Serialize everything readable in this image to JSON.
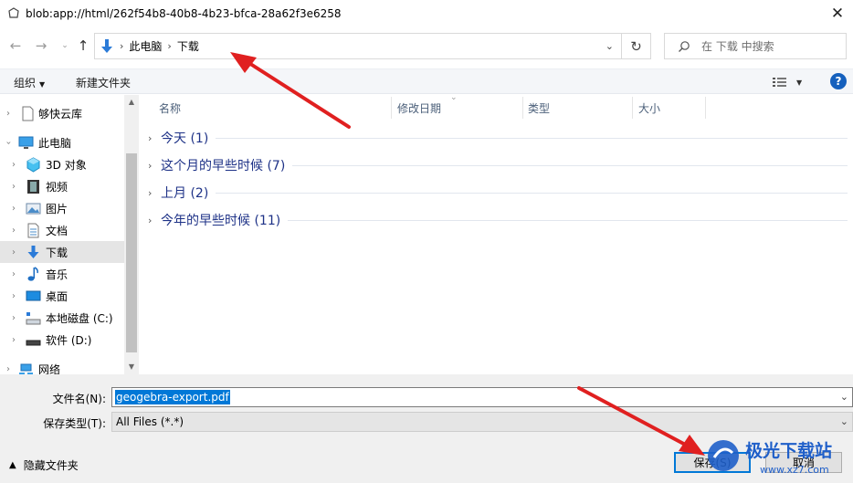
{
  "window": {
    "title": "blob:app://html/262f54b8-40b8-4b23-bfca-28a62f3e6258",
    "close_glyph": "✕"
  },
  "address": {
    "crumb_root": "此电脑",
    "crumb_current": "下载",
    "search_placeholder": "在 下载 中搜索"
  },
  "toolbar": {
    "organize_label": "组织",
    "new_folder_label": "新建文件夹"
  },
  "nav": {
    "items": [
      {
        "label": "够快云库",
        "icon": "document-icon"
      },
      {
        "label": "此电脑",
        "icon": "computer-icon"
      },
      {
        "label": "3D 对象",
        "icon": "cube-3d-icon"
      },
      {
        "label": "视频",
        "icon": "video-icon"
      },
      {
        "label": "图片",
        "icon": "picture-icon"
      },
      {
        "label": "文档",
        "icon": "documents-icon"
      },
      {
        "label": "下载",
        "icon": "download-icon"
      },
      {
        "label": "音乐",
        "icon": "music-icon"
      },
      {
        "label": "桌面",
        "icon": "desktop-icon"
      },
      {
        "label": "本地磁盘 (C:)",
        "icon": "drive-c-icon"
      },
      {
        "label": "软件 (D:)",
        "icon": "drive-d-icon"
      },
      {
        "label": "网络",
        "icon": "network-icon"
      }
    ],
    "selected": "下载"
  },
  "columns": {
    "name": "名称",
    "modified": "修改日期",
    "type": "类型",
    "size": "大小"
  },
  "groups": [
    {
      "title": "今天 (1)"
    },
    {
      "title": "这个月的早些时候 (7)"
    },
    {
      "title": "上月 (2)"
    },
    {
      "title": "今年的早些时候 (11)"
    }
  ],
  "form": {
    "filename_label": "文件名(N):",
    "filename_value": "geogebra-export.pdf",
    "filetype_label": "保存类型(T):",
    "filetype_value": "All Files (*.*)",
    "hide_folders_label": "隐藏文件夹",
    "save_label": "保存(S)",
    "cancel_label": "取消"
  },
  "watermark": {
    "text": "极光下载站",
    "url": "www.xz7.com"
  },
  "colors": {
    "accent": "#0078d7",
    "annotation_arrow": "#e02020",
    "group_title": "#1e3287"
  }
}
